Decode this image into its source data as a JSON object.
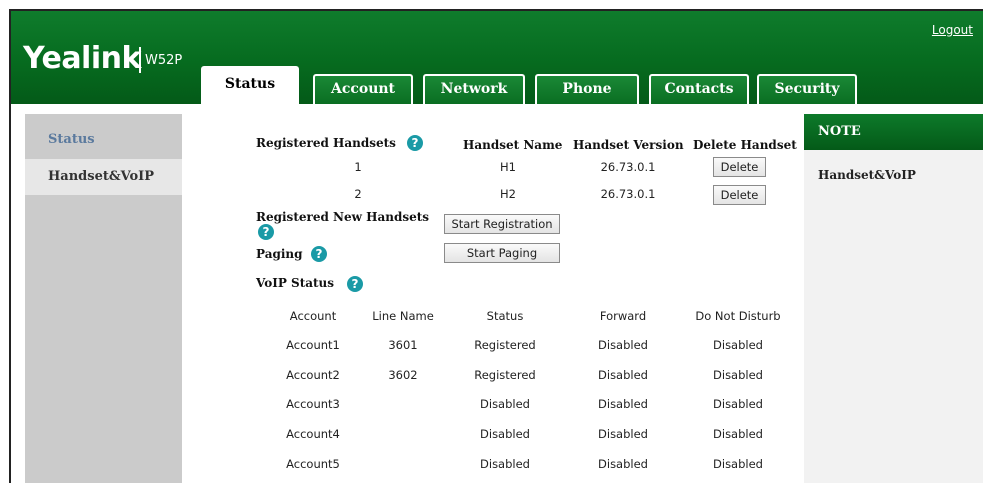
{
  "header": {
    "brand": "Yealink",
    "model": "W52P",
    "logout": "Logout"
  },
  "tabs": [
    {
      "label": "Status",
      "active": true
    },
    {
      "label": "Account",
      "active": false
    },
    {
      "label": "Network",
      "active": false
    },
    {
      "label": "Phone",
      "active": false
    },
    {
      "label": "Contacts",
      "active": false
    },
    {
      "label": "Security",
      "active": false
    }
  ],
  "sidebar": {
    "items": [
      {
        "label": "Status"
      },
      {
        "label": "Handset&VoIP"
      }
    ]
  },
  "handsets": {
    "label": "Registered Handsets",
    "columns": [
      "Handset Name",
      "Handset Version",
      "Delete Handset"
    ],
    "rows": [
      {
        "index": "1",
        "name": "H1",
        "version": "26.73.0.1",
        "action": "Delete"
      },
      {
        "index": "2",
        "name": "H2",
        "version": "26.73.0.1",
        "action": "Delete"
      }
    ]
  },
  "registration": {
    "label": "Registered New Handsets",
    "button": "Start Registration"
  },
  "paging": {
    "label": "Paging",
    "button": "Start Paging"
  },
  "voip": {
    "label": "VoIP Status",
    "columns": [
      "Account",
      "Line Name",
      "Status",
      "Forward",
      "Do Not Disturb"
    ],
    "rows": [
      {
        "account": "Account1",
        "line": "3601",
        "status": "Registered",
        "forward": "Disabled",
        "dnd": "Disabled"
      },
      {
        "account": "Account2",
        "line": "3602",
        "status": "Registered",
        "forward": "Disabled",
        "dnd": "Disabled"
      },
      {
        "account": "Account3",
        "line": "",
        "status": "Disabled",
        "forward": "Disabled",
        "dnd": "Disabled"
      },
      {
        "account": "Account4",
        "line": "",
        "status": "Disabled",
        "forward": "Disabled",
        "dnd": "Disabled"
      },
      {
        "account": "Account5",
        "line": "",
        "status": "Disabled",
        "forward": "Disabled",
        "dnd": "Disabled"
      }
    ]
  },
  "note": {
    "title": "NOTE",
    "body": "Handset&VoIP"
  },
  "help_icon": "?",
  "colors": {
    "brand_green": "#066b1f",
    "help_teal": "#1a9aa6",
    "sidebar_gray": "#cbcbcb"
  }
}
